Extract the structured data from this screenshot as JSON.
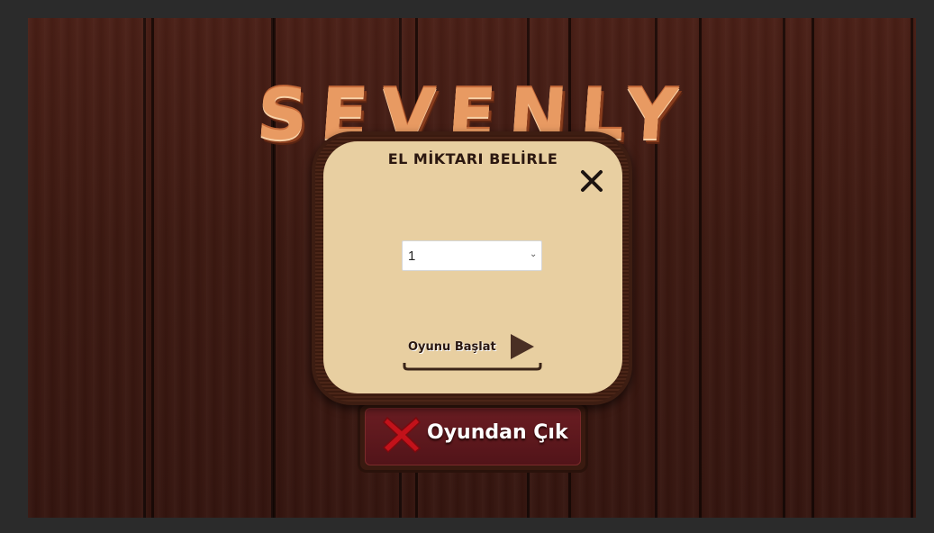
{
  "game": {
    "logo": "SEVENLY",
    "exit_button_label": "Oyundan Çık"
  },
  "modal": {
    "title": "EL MİKTARI BELİRLE",
    "select": {
      "selected_value": "1",
      "options": [
        "1"
      ]
    },
    "start_button_label": "Oyunu Başlat"
  },
  "icons": {
    "close": "close-icon",
    "exit": "red-x-icon",
    "start": "play-icon"
  },
  "colors": {
    "wood_background": "#3d1911",
    "modal_panel": "#e8cfa1",
    "modal_frame": "#3d1d12",
    "exit_button": "#5a161b",
    "logo_orange": "#e89a62",
    "exit_x_red": "#c2121a",
    "play_arrow": "#4a2f24"
  }
}
